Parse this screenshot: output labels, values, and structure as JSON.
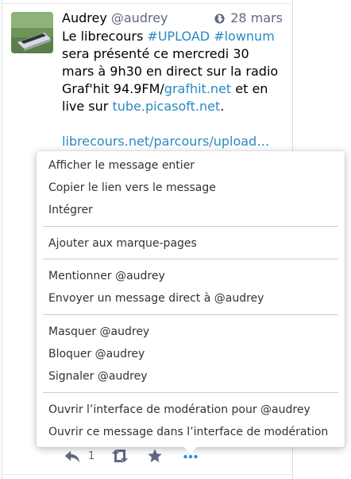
{
  "status": {
    "display_name": "Audrey",
    "acct": "@audrey",
    "date": "28 mars",
    "visibility_icon": "globe-icon",
    "content": {
      "l1_pre": "Le librecours ",
      "hashtag1": "#UPLOAD",
      "l1_sp": " ",
      "hashtag2": "#lownum",
      "l2": "sera présenté ce mercredi 30",
      "l3": "mars à 9h30 en direct sur la radio",
      "l4_pre": "Graf'hit 94.9FM/",
      "l4_link": "grafhit.net",
      "l4_post": " et en",
      "l5_pre": "live sur ",
      "l5_link": "tube.picasoft.net",
      "l5_post": ".",
      "l6_link": "librecours.net/parcours/upload…"
    },
    "actions": {
      "reply_icon": "reply-icon",
      "reply_count": "1",
      "boost_icon": "boost-icon",
      "favourite_icon": "star-icon",
      "more_icon": "ellipsis-icon"
    }
  },
  "menu": {
    "items": [
      "Afficher le message entier",
      "Copier le lien vers le message",
      "Intégrer",
      "Ajouter aux marque-pages",
      "Mentionner @audrey",
      "Envoyer un message direct à @audrey",
      "Masquer @audrey",
      "Bloquer @audrey",
      "Signaler @audrey",
      "Ouvrir l’interface de modération pour @audrey",
      "Ouvrir ce message dans l’interface de modération"
    ]
  },
  "colors": {
    "link": "#2a89c2",
    "muted": "#606984",
    "action_active": "#2b90d9",
    "menu_text": "#2f323a"
  }
}
